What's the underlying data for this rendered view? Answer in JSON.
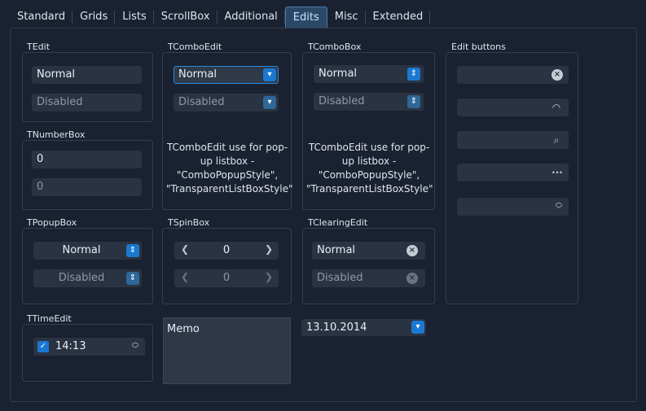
{
  "tabs": [
    "Standard",
    "Grids",
    "Lists",
    "ScrollBox",
    "Additional",
    "Edits",
    "Misc",
    "Extended"
  ],
  "active_tab": "Edits",
  "tedit": {
    "caption": "TEdit",
    "normal": "Normal",
    "disabled": "Disabled"
  },
  "tcomboedit": {
    "caption": "TComboEdit",
    "normal": "Normal",
    "disabled": "Disabled",
    "note": "TComboEdit use for pop-up listbox - \"ComboPopupStyle\", \"TransparentListBoxStyle\""
  },
  "tcombobox": {
    "caption": "TComboBox",
    "normal": "Normal",
    "disabled": "Disabled",
    "note": "TComboEdit use for pop-up listbox - \"ComboPopupStyle\", \"TransparentListBoxStyle\""
  },
  "editbuttons": {
    "caption": "Edit buttons"
  },
  "tnumberbox": {
    "caption": "TNumberBox",
    "normal": "0",
    "disabled": "0"
  },
  "tpopupbox": {
    "caption": "TPopupBox",
    "normal": "Normal",
    "disabled": "Disabled"
  },
  "tspinbox": {
    "caption": "TSpinBox",
    "normal": "0",
    "disabled": "0"
  },
  "tclearingedit": {
    "caption": "TClearingEdit",
    "normal": "Normal",
    "disabled": "Disabled"
  },
  "ttimeedit": {
    "caption": "TTimeEdit",
    "value": "14:13"
  },
  "memo": {
    "text": "Memo"
  },
  "dateedit": {
    "value": "13.10.2014"
  },
  "colors": {
    "accent": "#1a78d0",
    "background": "#1a2231",
    "field": "#2a3342"
  }
}
